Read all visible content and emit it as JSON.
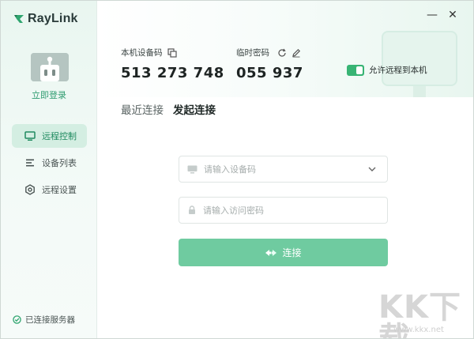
{
  "app": {
    "name": "RayLink"
  },
  "window": {
    "minimize_glyph": "—",
    "close_glyph": "✕"
  },
  "sidebar": {
    "login_label": "立即登录",
    "items": [
      {
        "label": "远程控制",
        "icon": "monitor-icon",
        "active": true
      },
      {
        "label": "设备列表",
        "icon": "list-icon",
        "active": false
      },
      {
        "label": "远程设置",
        "icon": "hexagon-settings-icon",
        "active": false
      }
    ],
    "server_status": "已连接服务器"
  },
  "codes": {
    "device_label": "本机设备码",
    "device_value": "513 273 748",
    "pass_label": "临时密码",
    "pass_value": "055 937"
  },
  "remote_toggle": {
    "label": "允许远程到本机",
    "on": true
  },
  "tabs": [
    {
      "label": "最近连接",
      "active": false
    },
    {
      "label": "发起连接",
      "active": true
    }
  ],
  "form": {
    "device_placeholder": "请输入设备码",
    "pass_placeholder": "请输入访问密码",
    "connect_label": "连接"
  },
  "watermark": {
    "text": "KK下载",
    "url": "www.kkx.net"
  },
  "colors": {
    "accent": "#38b474",
    "accent_light": "#6fcba0",
    "sidebar_active": "#d4eee2"
  }
}
